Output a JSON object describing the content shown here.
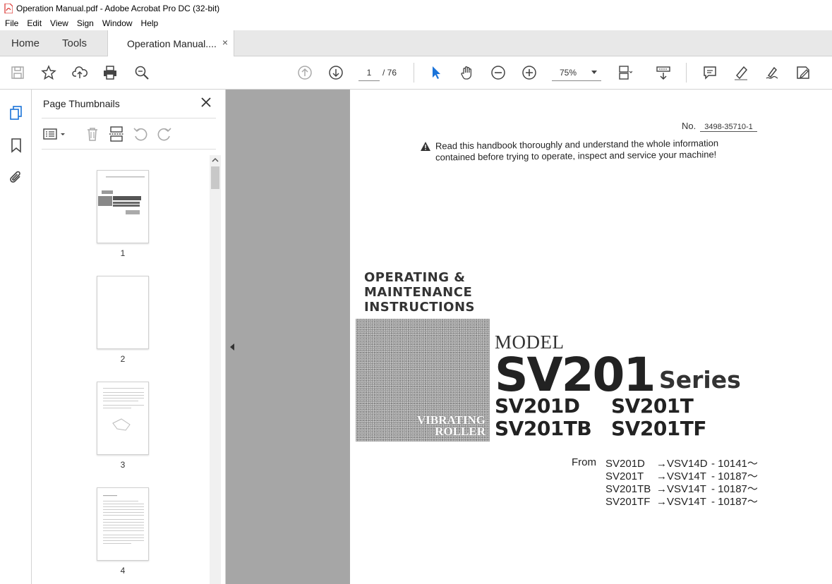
{
  "window": {
    "title": "Operation Manual.pdf - Adobe Acrobat Pro DC (32-bit)"
  },
  "menu": [
    "File",
    "Edit",
    "View",
    "Sign",
    "Window",
    "Help"
  ],
  "tabs": {
    "home": "Home",
    "tools": "Tools",
    "document": "Operation Manual....",
    "close": "×"
  },
  "toolbar": {
    "current_page": "1",
    "page_total": "/  76",
    "zoom": "75%",
    "icons": [
      "save-icon",
      "star-icon",
      "upload-icon",
      "print-icon",
      "search-icon",
      "page-up-icon",
      "page-down-icon",
      "select-arrow-icon",
      "hand-icon",
      "zoom-out-icon",
      "zoom-in-icon",
      "page-fit-icon",
      "scroll-mode-icon",
      "comment-icon",
      "highlight-icon",
      "sign-icon",
      "edit-pdf-icon"
    ]
  },
  "panel": {
    "title": "Page Thumbnails",
    "thumbnails": [
      {
        "num": "1"
      },
      {
        "num": "2"
      },
      {
        "num": "3"
      },
      {
        "num": "4"
      }
    ]
  },
  "document": {
    "doc_no_label": "No.",
    "doc_no_value": "3498-35710-1",
    "warning_line1": "Read this handbook thoroughly and understand the whole information",
    "warning_line2": "contained before trying to operate, inspect and service your machine!",
    "title_line1": "OPERATING  &",
    "title_line2": "MAINTENANCE",
    "title_line3": "INSTRUCTIONS",
    "image_line1": "VIBRATING",
    "image_line2": "ROLLER",
    "model_label": "MODEL",
    "model_main": "SV201",
    "series_word": "Series",
    "variants": [
      "SV201D",
      "SV201T",
      "SV201TB",
      "SV201TF"
    ],
    "from_label": "From",
    "from_rows": [
      {
        "model": "SV201D",
        "serial": "→VSV14D",
        "number": "- 10141～"
      },
      {
        "model": "SV201T",
        "serial": "→VSV14T",
        "number": "- 10187～"
      },
      {
        "model": "SV201TB",
        "serial": "→VSV14T",
        "number": "- 10187～"
      },
      {
        "model": "SV201TF",
        "serial": "→VSV14T",
        "number": "- 10187～"
      }
    ]
  },
  "colors": {
    "accent": "#1a73d9",
    "pdf_red": "#d9302c",
    "doc_background": "#a6a6a6"
  }
}
